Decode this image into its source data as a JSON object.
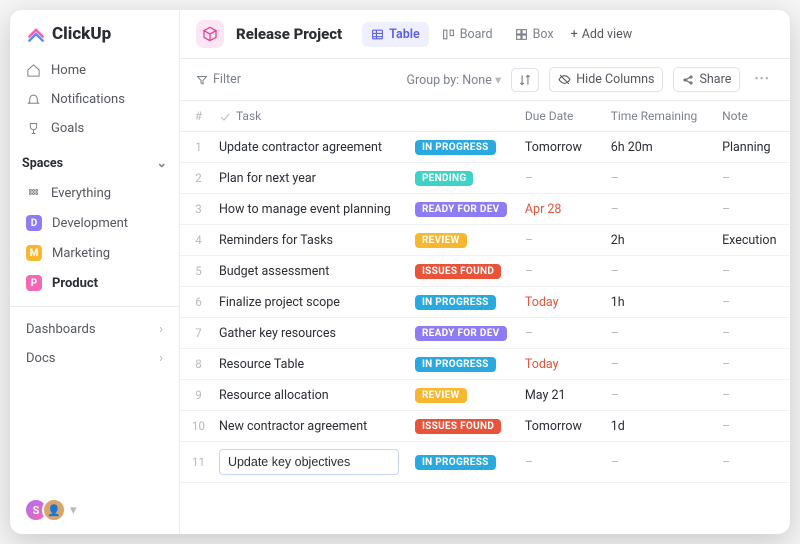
{
  "brand": {
    "name": "ClickUp"
  },
  "nav": {
    "home": "Home",
    "notifications": "Notifications",
    "goals": "Goals"
  },
  "spaces": {
    "header": "Spaces",
    "everything": "Everything",
    "items": [
      {
        "label": "Development",
        "badge": "D",
        "color": "#8e7cf7"
      },
      {
        "label": "Marketing",
        "badge": "M",
        "color": "#f7b731"
      },
      {
        "label": "Product",
        "badge": "P",
        "color": "#f368b6",
        "active": true
      }
    ]
  },
  "sections": {
    "dashboards": "Dashboards",
    "docs": "Docs"
  },
  "header": {
    "project_title": "Release Project",
    "tabs": {
      "table": "Table",
      "board": "Board",
      "box": "Box"
    },
    "add_view": "Add view"
  },
  "toolbar": {
    "filter": "Filter",
    "group_by_label": "Group by:",
    "group_by_value": "None",
    "hide_columns": "Hide Columns",
    "share": "Share"
  },
  "table": {
    "col_num": "#",
    "col_task": "Task",
    "col_status": "",
    "col_due": "Due Date",
    "col_time": "Time Remaining",
    "col_note": "Note"
  },
  "status_colors": {
    "IN PROGRESS": "#2aa8e0",
    "PENDING": "#3fd2c7",
    "READY FOR DEV": "#8e7cf7",
    "REVIEW": "#f7b731",
    "ISSUES FOUND": "#e8533a"
  },
  "rows": [
    {
      "num": "1",
      "task": "Update contractor agreement",
      "status": "IN PROGRESS",
      "due": "Tomorrow",
      "due_red": false,
      "time": "6h 20m",
      "note": "Planning"
    },
    {
      "num": "2",
      "task": "Plan for next year",
      "status": "PENDING",
      "due": "–",
      "due_red": false,
      "time": "–",
      "note": "–"
    },
    {
      "num": "3",
      "task": "How to manage event planning",
      "status": "READY FOR DEV",
      "due": "Apr 28",
      "due_red": true,
      "time": "–",
      "note": "–"
    },
    {
      "num": "4",
      "task": "Reminders for Tasks",
      "status": "REVIEW",
      "due": "–",
      "due_red": false,
      "time": "2h",
      "note": "Execution"
    },
    {
      "num": "5",
      "task": "Budget assessment",
      "status": "ISSUES FOUND",
      "due": "–",
      "due_red": false,
      "time": "–",
      "note": "–"
    },
    {
      "num": "6",
      "task": "Finalize project scope",
      "status": "IN PROGRESS",
      "due": "Today",
      "due_red": true,
      "time": "1h",
      "note": "–"
    },
    {
      "num": "7",
      "task": "Gather key resources",
      "status": "READY FOR DEV",
      "due": "–",
      "due_red": false,
      "time": "–",
      "note": "–"
    },
    {
      "num": "8",
      "task": "Resource Table",
      "status": "IN PROGRESS",
      "due": "Today",
      "due_red": true,
      "time": "–",
      "note": "–"
    },
    {
      "num": "9",
      "task": "Resource allocation",
      "status": "REVIEW",
      "due": "May 21",
      "due_red": false,
      "time": "–",
      "note": "–"
    },
    {
      "num": "10",
      "task": "New contractor agreement",
      "status": "ISSUES FOUND",
      "due": "Tomorrow",
      "due_red": false,
      "time": "1d",
      "note": "–"
    },
    {
      "num": "11",
      "task": "Update key objectives",
      "status": "IN PROGRESS",
      "due": "–",
      "due_red": false,
      "time": "–",
      "note": "–",
      "editing": true
    }
  ]
}
